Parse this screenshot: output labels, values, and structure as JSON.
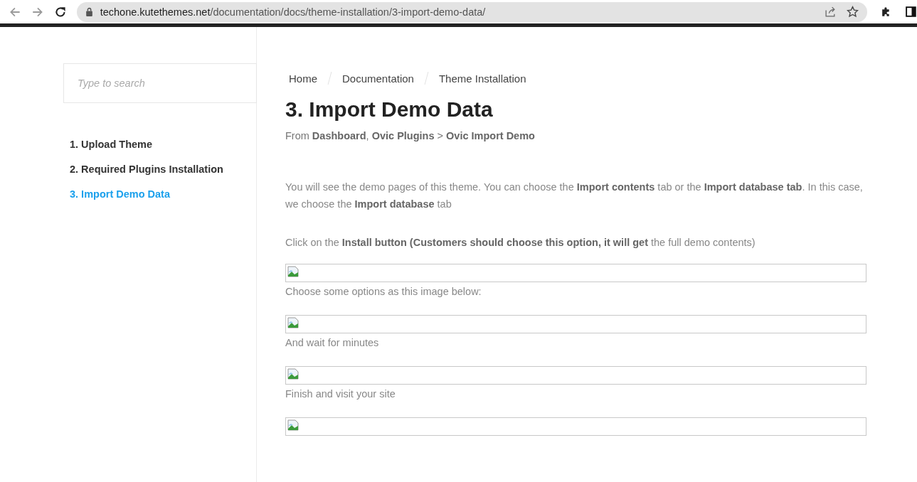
{
  "browser": {
    "url_host": "techone.kutethemes.net",
    "url_path": "/documentation/docs/theme-installation/3-import-demo-data/"
  },
  "sidebar": {
    "search": {
      "placeholder": "Type to search"
    },
    "items": [
      {
        "label": "1. Upload Theme",
        "selected": false
      },
      {
        "label": "2. Required Plugins Installation",
        "selected": false
      },
      {
        "label": "3. Import Demo Data",
        "selected": true
      }
    ]
  },
  "breadcrumb": [
    "Home",
    "Documentation",
    "Theme Installation"
  ],
  "title": "3. Import Demo Data",
  "subtitle": "From **Dashboard**, **Ovic Plugins** > **Ovic Import Demo**",
  "content": [
    {
      "kind": "paragraph",
      "text": "You will see the demo pages of this theme. You can choose the **Import contents** tab or the **Import database tab**. In this case, we choose the **Import database** tab"
    },
    {
      "kind": "paragraph",
      "text": "Click on the **Install button (Customers should choose this option, it will get** the full demo contents)"
    },
    {
      "kind": "image"
    },
    {
      "kind": "caption",
      "text": "Choose some options as this image below:"
    },
    {
      "kind": "image"
    },
    {
      "kind": "caption",
      "text": "And wait for minutes"
    },
    {
      "kind": "image"
    },
    {
      "kind": "caption",
      "text": "Finish and visit your site"
    },
    {
      "kind": "image"
    }
  ]
}
